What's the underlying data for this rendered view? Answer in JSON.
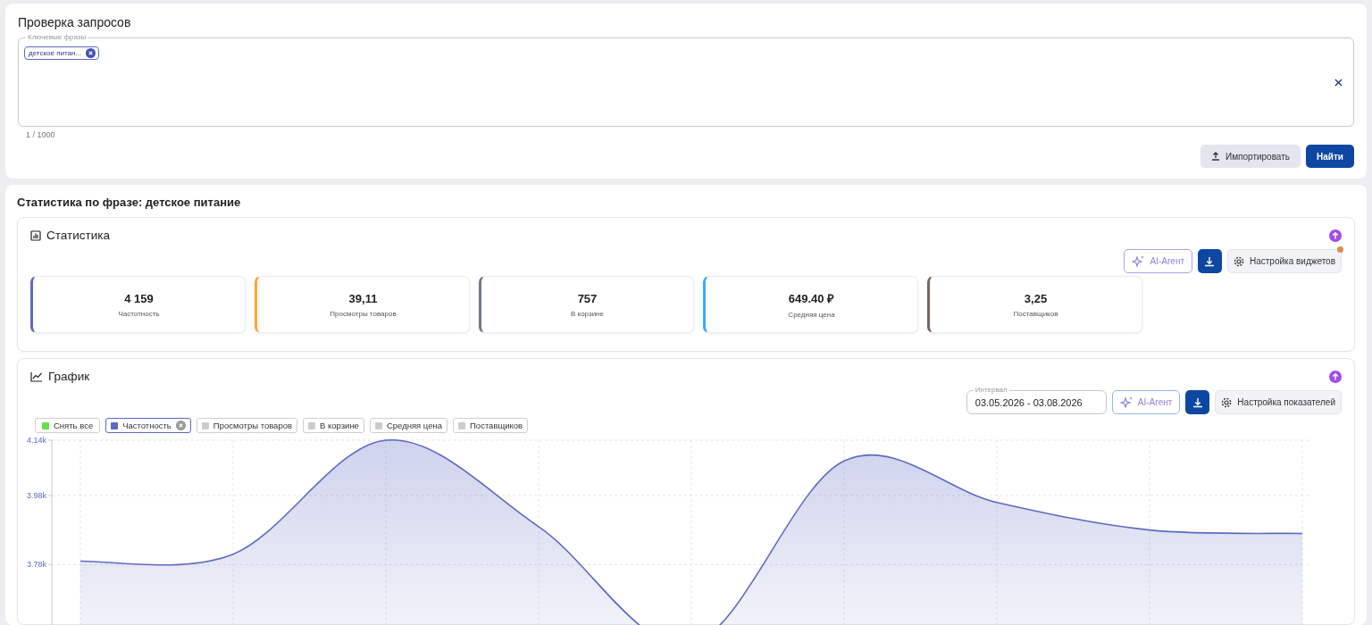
{
  "query_check": {
    "title": "Проверка запросов",
    "field": {
      "label": "Ключевые фразы",
      "chips": [
        "детское питан..."
      ],
      "counter": "1 / 1000"
    },
    "buttons": [
      {
        "kind": "secondary",
        "label": "Импортировать"
      },
      {
        "kind": "primary",
        "label": "Найти"
      }
    ]
  },
  "stats_section": {
    "title": "Статистика по фразе: детское питание",
    "statistics": {
      "title": "Статистика",
      "ai_button": "AI-Агент",
      "settings_button": "Настройка виджетов",
      "settings_notice": true,
      "cards": [
        {
          "value": "4 159",
          "label": "Частотность",
          "color": "#5c6bc0"
        },
        {
          "value": "39,11",
          "label": "Просмотры товаров",
          "color": "#ffa537"
        },
        {
          "value": "757",
          "label": "В корзине",
          "color": "#6f7a8a"
        },
        {
          "value": "649.40 ₽",
          "label": "Средняя цена",
          "color": "#35aef0"
        },
        {
          "value": "3,25",
          "label": "Поставщиков",
          "color": "#7a6560"
        }
      ]
    },
    "graph": {
      "title": "График",
      "interval_label": "Интервал",
      "interval": "03.05.2026 - 03.08.2026",
      "ai_button": "AI-Агент",
      "settings_button": "Настройка показателей",
      "legend": [
        {
          "kind": "toggle-all",
          "label": "Снять все",
          "selected": false,
          "color": "#66e04a"
        },
        {
          "kind": "series",
          "label": "Частотность",
          "selected": true,
          "color": "#5c6bc0"
        },
        {
          "kind": "series",
          "label": "Просмотры товаров",
          "selected": false,
          "color": "#cccccc"
        },
        {
          "kind": "series",
          "label": "В корзине",
          "selected": false,
          "color": "#cccccc"
        },
        {
          "kind": "series",
          "label": "Средняя цена",
          "selected": false,
          "color": "#cccccc"
        },
        {
          "kind": "series",
          "label": "Поставщиков",
          "selected": false,
          "color": "#cccccc"
        }
      ],
      "chart_data": {
        "type": "area",
        "categories": [
          null,
          null,
          null,
          null,
          null,
          null,
          null,
          null,
          null
        ],
        "ylim": [
          3520,
          4140
        ],
        "grid": true,
        "yticks": [
          {
            "value": 4140,
            "label": "4.14k"
          },
          {
            "value": 3980,
            "label": "3.98k"
          },
          {
            "value": 3780,
            "label": "3.78k"
          }
        ],
        "series": [
          {
            "color": "#5c6bc0",
            "values": [
              3790,
              3810,
              4140,
              3890,
              3550,
              4080,
              3960,
              3880,
              3870
            ]
          }
        ]
      }
    }
  }
}
